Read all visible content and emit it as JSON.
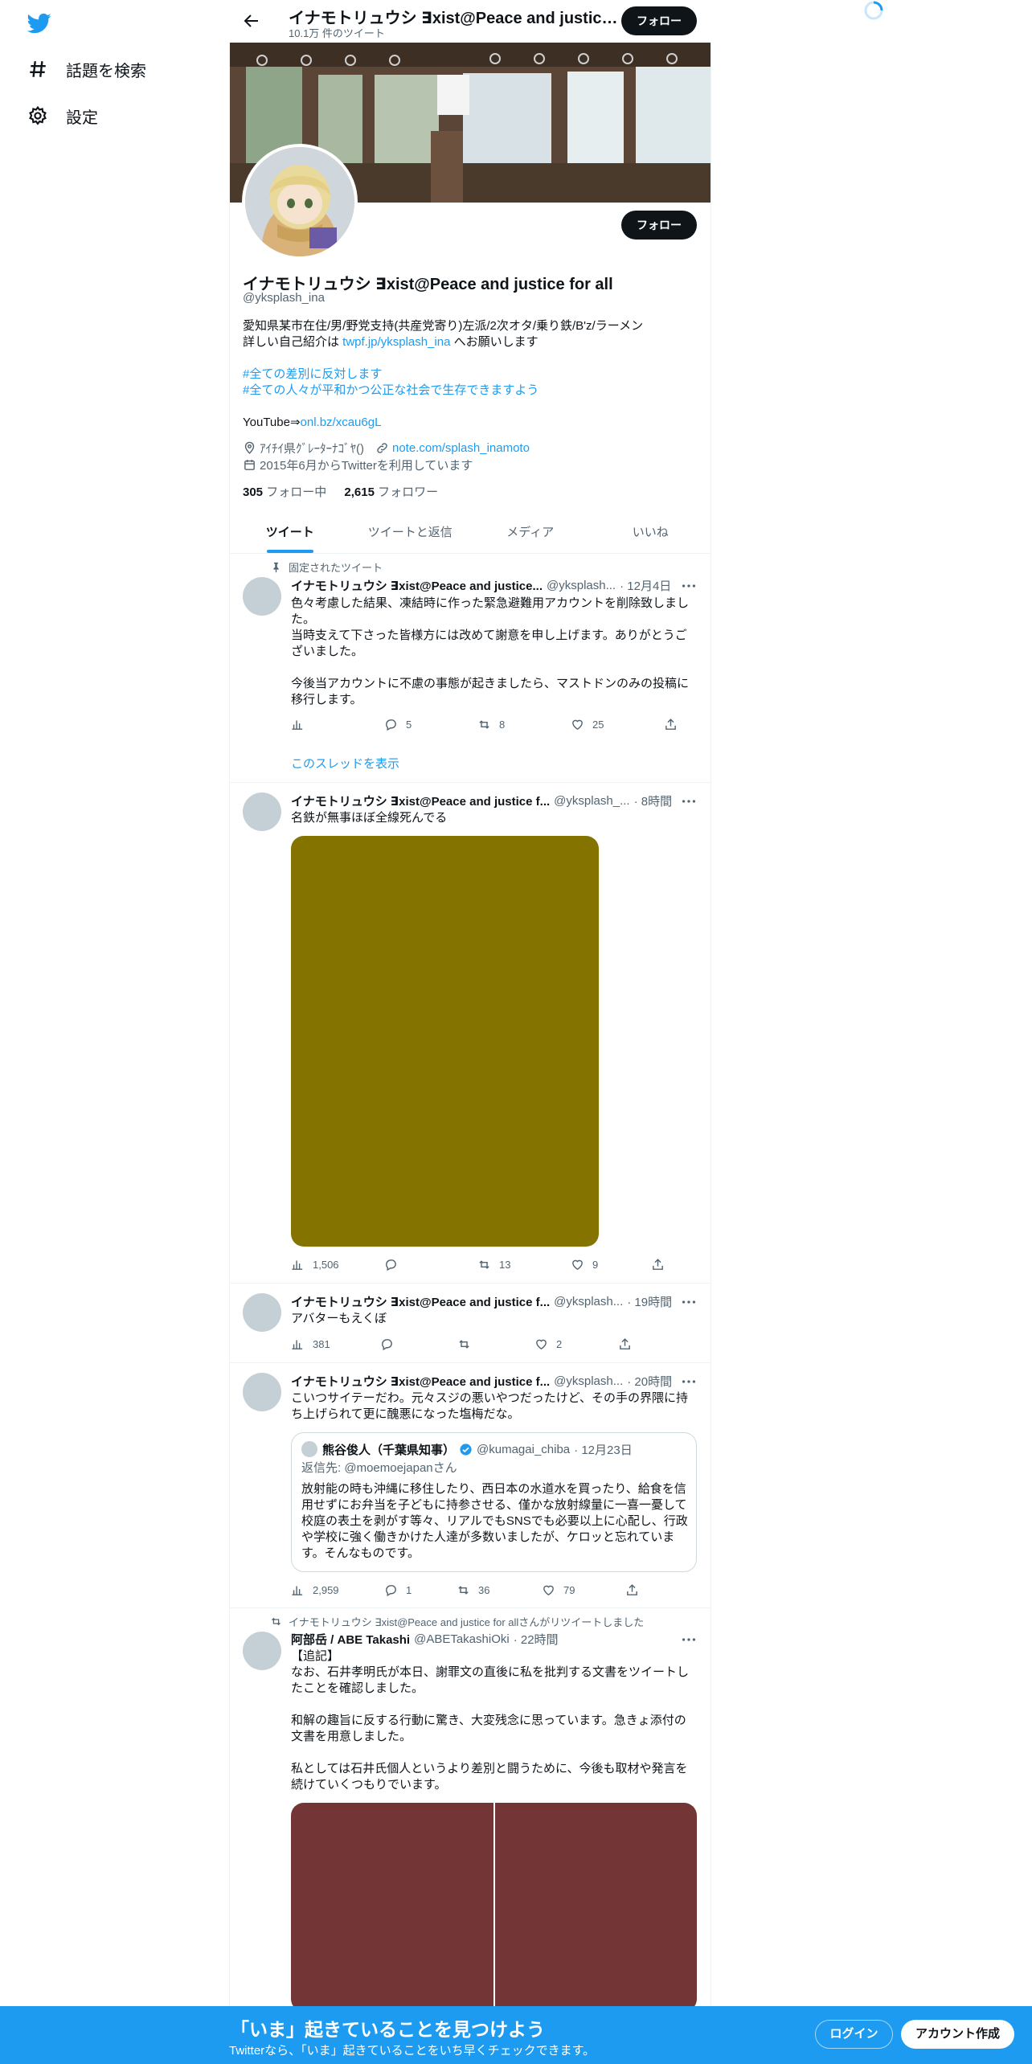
{
  "nav": {
    "items": [
      {
        "label": "話題を検索",
        "icon": "hashtag-icon"
      },
      {
        "label": "設定",
        "icon": "gear-icon"
      }
    ]
  },
  "header": {
    "title": "イナモトリュウシ ∃xist@Peace and justice ...",
    "subtitle": "10.1万 件のツイート",
    "follow_label": "フォロー"
  },
  "profile": {
    "name": "イナモトリュウシ ∃xist@Peace and justice for all",
    "handle": "@yksplash_ina",
    "follow_label": "フォロー",
    "bio_line1": "愛知県某市在住/男/野党支持(共産党寄り)左派/2次オタ/乗り鉄/B'z/ラーメン",
    "bio_line2_prefix": "詳しい自己紹介は ",
    "bio_line2_link": "twpf.jp/yksplash_ina",
    "bio_line2_suffix": " へお願いします",
    "hashtag1": "#全ての差別に反対します",
    "hashtag2": "#全ての人々が平和かつ公正な社会で生存できますよう",
    "youtube_prefix": "YouTube⇒",
    "youtube_link": "onl.bz/xcau6gL",
    "location": "ｱｲﾁｲ県ｸﾞﾚｰﾀｰﾅｺﾞﾔ()",
    "website": "note.com/splash_inamoto",
    "joined": "2015年6月からTwitterを利用しています",
    "following_count": "305",
    "following_label": " フォロー中",
    "followers_count": "2,615",
    "followers_label": " フォロワー"
  },
  "tabs": [
    "ツイート",
    "ツイートと返信",
    "メディア",
    "いいね"
  ],
  "tweets": [
    {
      "context": "固定されたツイート",
      "name": "イナモトリュウシ ∃xist@Peace and justice...",
      "handle": "@yksplash...",
      "time": "· 12月4日",
      "text": "色々考慮した結果、凍結時に作った緊急避難用アカウントを削除致しました。\n当時支えて下さった皆様方には改めて謝意を申し上げます。ありがとうございました。\n\n今後当アカウントに不慮の事態が起きましたら、マストドンのみの投稿に移行します。",
      "views": "",
      "replies": "5",
      "retweets": "8",
      "likes": "25",
      "thread_link": "このスレッドを表示"
    },
    {
      "name": "イナモトリュウシ ∃xist@Peace and justice f...",
      "handle": "@yksplash_...",
      "time": "· 8時間",
      "text": "名鉄が無事ほぼ全線死んでる",
      "views": "1,506",
      "replies": "",
      "retweets": "13",
      "likes": "9",
      "media_color": "#857300"
    },
    {
      "name": "イナモトリュウシ ∃xist@Peace and justice f...",
      "handle": "@yksplash...",
      "time": "· 19時間",
      "text": "アバターもえくぼ",
      "views": "381",
      "replies": "",
      "retweets": "",
      "likes": "2"
    },
    {
      "name": "イナモトリュウシ ∃xist@Peace and justice f...",
      "handle": "@yksplash...",
      "time": "· 20時間",
      "text": "こいつサイテーだわ。元々スジの悪いやつだったけど、その手の界隈に持ち上げられて更に醜悪になった塩梅だな。",
      "views": "2,959",
      "replies": "1",
      "retweets": "36",
      "likes": "79",
      "quote": {
        "name": "熊谷俊人（千葉県知事）",
        "handle": "@kumagai_chiba",
        "time": "· 12月23日",
        "reply_prefix": "返信先: ",
        "reply_to": "@moemoejapan",
        "reply_suffix": "さん",
        "text": "放射能の時も沖縄に移住したり、西日本の水道水を買ったり、給食を信用せずにお弁当を子どもに持参させる、僅かな放射線量に一喜一憂して校庭の表土を剥がす等々、リアルでもSNSでも必要以上に心配し、行政や学校に強く働きかけた人達が多数いましたが、ケロッと忘れています。そんなものです。"
      }
    },
    {
      "context": "イナモトリュウシ ∃xist@Peace and justice for allさんがリツイートしました",
      "name": "阿部岳 / ABE Takashi",
      "handle": "@ABETakashiOki",
      "time": "· 22時間",
      "text": "【追記】\nなお、石井孝明氏が本日、謝罪文の直後に私を批判する文書をツイートしたことを確認しました。\n\n和解の趣旨に反する行動に驚き、大変残念に思っています。急きょ添付の文書を用意しました。\n\n私としては石井氏個人というより差別と闘うために、今後も取材や発言を続けていくつもりでいます。",
      "media_color": "#733535"
    }
  ],
  "bottom": {
    "title": "「いま」起きていることを見つけよう",
    "subtitle": "Twitterなら、「いま」起きていることをいち早くチェックできます。",
    "login": "ログイン",
    "signup": "アカウント作成"
  }
}
